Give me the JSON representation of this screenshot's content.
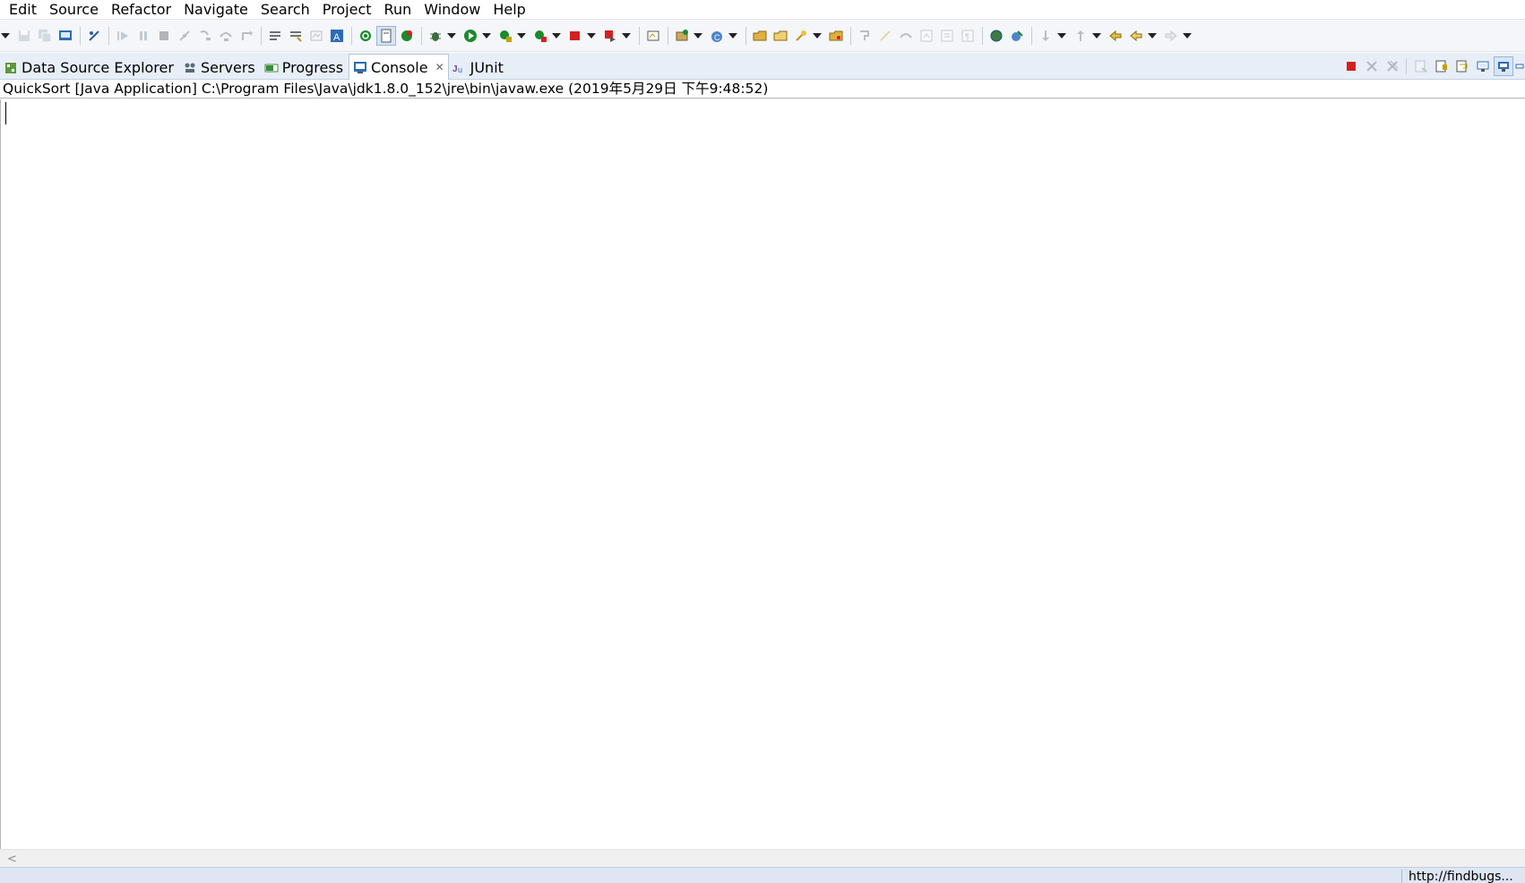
{
  "menubar": {
    "items": [
      {
        "label": "Edit"
      },
      {
        "label": "Source"
      },
      {
        "label": "Refactor"
      },
      {
        "label": "Navigate"
      },
      {
        "label": "Search"
      },
      {
        "label": "Project"
      },
      {
        "label": "Run"
      },
      {
        "label": "Window"
      },
      {
        "label": "Help"
      }
    ]
  },
  "view_tabs": [
    {
      "label": "Data Source Explorer",
      "icon": "data-source-explorer-icon"
    },
    {
      "label": "Servers",
      "icon": "servers-icon"
    },
    {
      "label": "Progress",
      "icon": "progress-icon"
    },
    {
      "label": "Console",
      "icon": "console-icon",
      "active": true
    },
    {
      "label": "JUnit",
      "icon": "junit-icon"
    }
  ],
  "console": {
    "title": "QuickSort [Java Application] C:\\Program Files\\Java\\jdk1.8.0_152\\jre\\bin\\javaw.exe (2019年5月29日 下午9:48:52)",
    "output": ""
  },
  "statusbar": {
    "text": "http://findbugs..."
  },
  "colors": {
    "toolbar_bg": "#f4f6f9",
    "viewbar_bg": "#e8eef7",
    "statusbar_bg": "#dde6f2",
    "terminate_red": "#d32020",
    "run_green": "#1c8a2e"
  }
}
